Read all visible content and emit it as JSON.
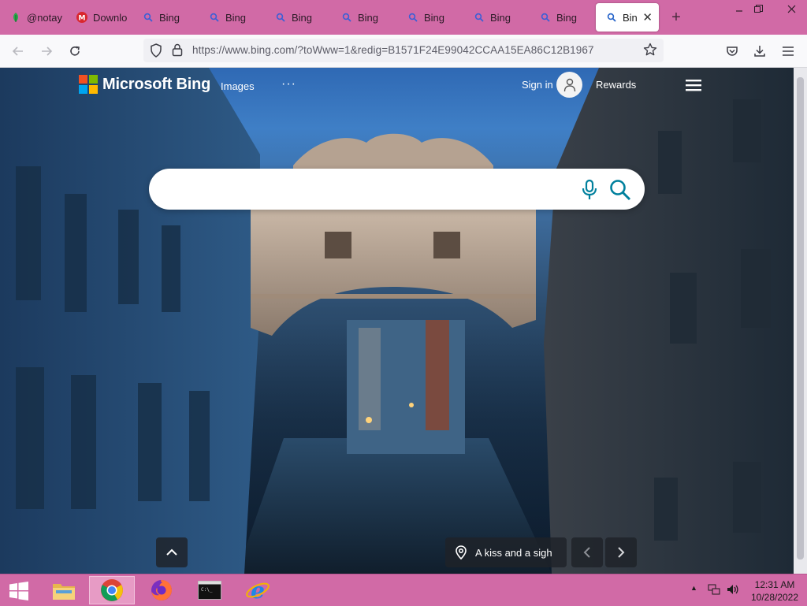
{
  "browser": {
    "tabs": [
      {
        "label": "@notay",
        "icon": "leaf-icon",
        "active": false
      },
      {
        "label": "Downlo",
        "icon": "mega-icon",
        "active": false
      },
      {
        "label": "Bing",
        "icon": "search-icon",
        "active": false
      },
      {
        "label": "Bing",
        "icon": "search-icon",
        "active": false
      },
      {
        "label": "Bing",
        "icon": "search-icon",
        "active": false
      },
      {
        "label": "Bing",
        "icon": "search-icon",
        "active": false
      },
      {
        "label": "Bing",
        "icon": "search-icon",
        "active": false
      },
      {
        "label": "Bing",
        "icon": "search-icon",
        "active": false
      },
      {
        "label": "Bing",
        "icon": "search-icon",
        "active": false
      },
      {
        "label": "Bing",
        "icon": "search-icon",
        "active": true
      }
    ],
    "address": "https://www.bing.com/?toWww=1&redig=B1571F24E99042CCAA15EA86C12B1967",
    "colors": {
      "tabstrip": "#d16aa6",
      "taskbar": "#d16aa6",
      "bing_accent": "#00809d"
    }
  },
  "bing": {
    "brand": "Microsoft Bing",
    "nav_images": "Images",
    "nav_more": "···",
    "signin": "Sign in",
    "rewards": "Rewards",
    "search_placeholder": "",
    "caption": "A kiss and a sigh"
  },
  "taskbar": {
    "apps": [
      "file-explorer-icon",
      "chrome-icon",
      "firefox-icon",
      "command-prompt-icon",
      "internet-explorer-icon"
    ],
    "time": "12:31 AM",
    "date": "10/28/2022"
  }
}
